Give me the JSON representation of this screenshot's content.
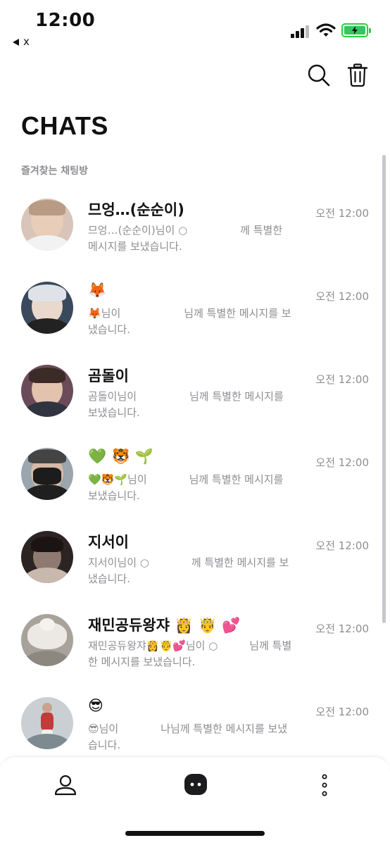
{
  "status_bar": {
    "time": "12:00",
    "back_label": "x",
    "icons": [
      "signal-icon",
      "wifi-icon",
      "battery-charging-icon"
    ],
    "battery_color": "#34c759"
  },
  "toolbar": {
    "icons": [
      "search-icon",
      "trash-icon"
    ]
  },
  "page_title": "CHATS",
  "section_label": "즐겨찾는 채팅방",
  "chats": [
    {
      "name": "므엉…(순순이)",
      "preview": "므엉…(순순이)님이 ○　　　　　께 특별한 메시지를 보냈습니다.",
      "time": "오전 12:00"
    },
    {
      "name": "🦊",
      "preview": "🦊님이　　　　　　님께 특별한 메시지를 보냈습니다.",
      "time": "오전 12:00"
    },
    {
      "name": "곰돌이",
      "preview": "곰돌이님이　　　　　님께 특별한 메시지를 보냈습니다.",
      "time": "오전 12:00"
    },
    {
      "name": "💚 🐯 🌱",
      "preview": "💚🐯🌱님이　　　　님께 특별한 메시지를 보냈습니다.",
      "time": "오전 12:00"
    },
    {
      "name": "지서이",
      "preview": "지서이님이 ○　　　　께 특별한 메시지를 보냈습니다.",
      "time": "오전 12:00"
    },
    {
      "name": "재민공듀왕쟈 👸 🤴 💕",
      "preview": "재민공듀왕쟈👸🤴💕님이 ○　　　님께 특별한 메시지를 보냈습니다.",
      "time": "오전 12:00"
    },
    {
      "name": "😎",
      "preview": "😎님이　　　　나님께 특별한 메시지를 보냈습니다.",
      "time": "오전 12:00"
    }
  ],
  "bottom_nav": {
    "items": [
      "person-icon",
      "chat-bubble-icon",
      "more-vertical-icon"
    ],
    "active": "chat-bubble-icon"
  }
}
